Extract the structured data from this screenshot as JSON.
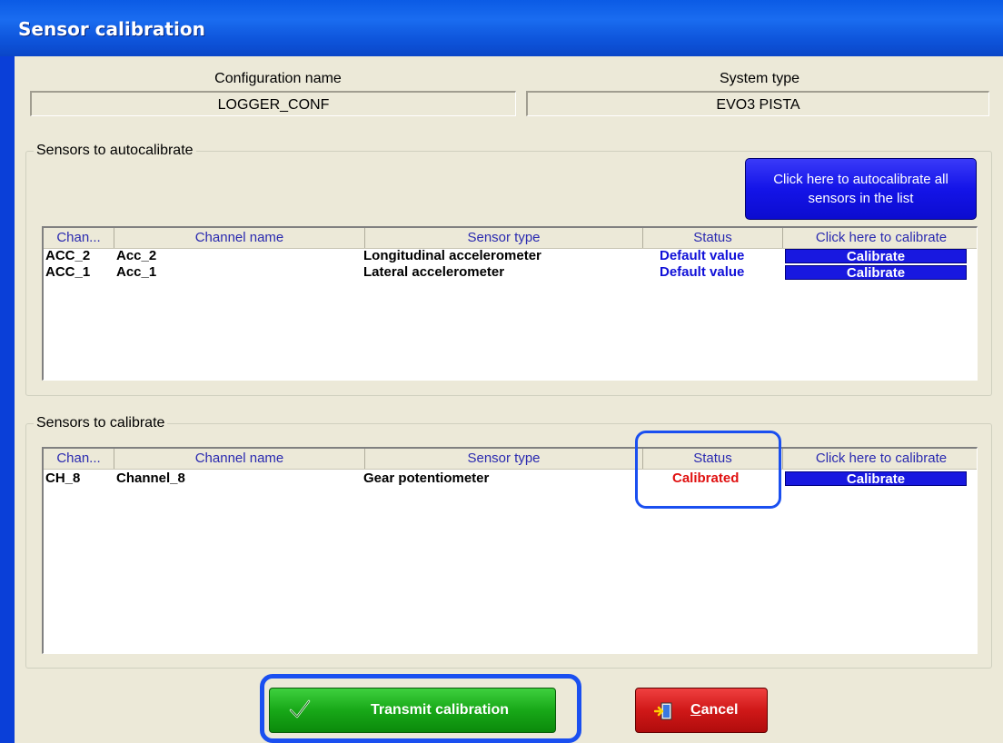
{
  "window": {
    "title": "Sensor calibration"
  },
  "config": {
    "config_label": "Configuration name",
    "config_value": "LOGGER_CONF",
    "system_label": "System type",
    "system_value": "EVO3 PISTA"
  },
  "autocal_group": {
    "title": "Sensors to autocalibrate",
    "button_label": "Click here to autocalibrate all sensors  in the list",
    "columns": [
      "Chan...",
      "Channel name",
      "Sensor type",
      "Status",
      "Click here to calibrate"
    ],
    "rows": [
      {
        "chan": "ACC_2",
        "name": "Acc_2",
        "type": "Longitudinal accelerometer",
        "status": "Default value",
        "action": "Calibrate"
      },
      {
        "chan": "ACC_1",
        "name": "Acc_1",
        "type": "Lateral accelerometer",
        "status": "Default value",
        "action": "Calibrate"
      }
    ]
  },
  "cal_group": {
    "title": "Sensors to calibrate",
    "columns": [
      "Chan...",
      "Channel name",
      "Sensor type",
      "Status",
      "Click here to calibrate"
    ],
    "rows": [
      {
        "chan": "CH_8",
        "name": "Channel_8",
        "type": "Gear potentiometer",
        "status": "Calibrated",
        "action": "Calibrate"
      }
    ]
  },
  "buttons": {
    "transmit": "Transmit calibration",
    "cancel_prefix": "C",
    "cancel_rest": "ancel"
  },
  "icons": {
    "transmit_icon": "check-icon",
    "cancel_icon": "exit-icon"
  },
  "colors": {
    "title_bar": "#0b5be5",
    "status_default": "#1010d8",
    "status_calibrated": "#e01010",
    "calibrate_button": "#1818e0",
    "transmit_button": "#18a818",
    "cancel_button": "#d01818",
    "highlight": "#1a4ff0"
  }
}
